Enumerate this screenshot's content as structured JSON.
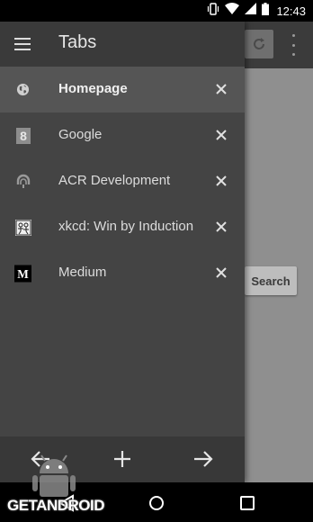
{
  "status_bar": {
    "time": "12:43",
    "icons": [
      "vibrate-icon",
      "wifi-icon",
      "signal-icon",
      "battery-icon"
    ]
  },
  "drawer": {
    "title": "Tabs",
    "menu_icon": "hamburger-icon",
    "tabs": [
      {
        "label": "Homepage",
        "icon": "globe-icon",
        "active": true
      },
      {
        "label": "Google",
        "icon": "google-icon",
        "active": false
      },
      {
        "label": "ACR Development",
        "icon": "acr-icon",
        "active": false
      },
      {
        "label": "xkcd: Win by Induction",
        "icon": "xkcd-icon",
        "active": false
      },
      {
        "label": "Medium",
        "icon": "medium-icon",
        "active": false
      }
    ],
    "bottom": {
      "back_icon": "arrow-left-icon",
      "add_icon": "plus-icon",
      "forward_icon": "arrow-right-icon"
    }
  },
  "browser": {
    "search_button_label": "Search",
    "refresh_icon": "refresh-icon",
    "overflow_icon": "overflow-menu-icon"
  },
  "nav_bar": {
    "back": "nav-back-icon",
    "home": "nav-home-icon",
    "recents": "nav-recents-icon"
  },
  "watermark": {
    "text": "GETANDROID"
  },
  "colors": {
    "drawer_bg": "#444444",
    "drawer_header": "#3a3a3a",
    "active_row": "#555555",
    "page_bg": "#8f8f8f",
    "toolbar": "#3b3b3b"
  }
}
